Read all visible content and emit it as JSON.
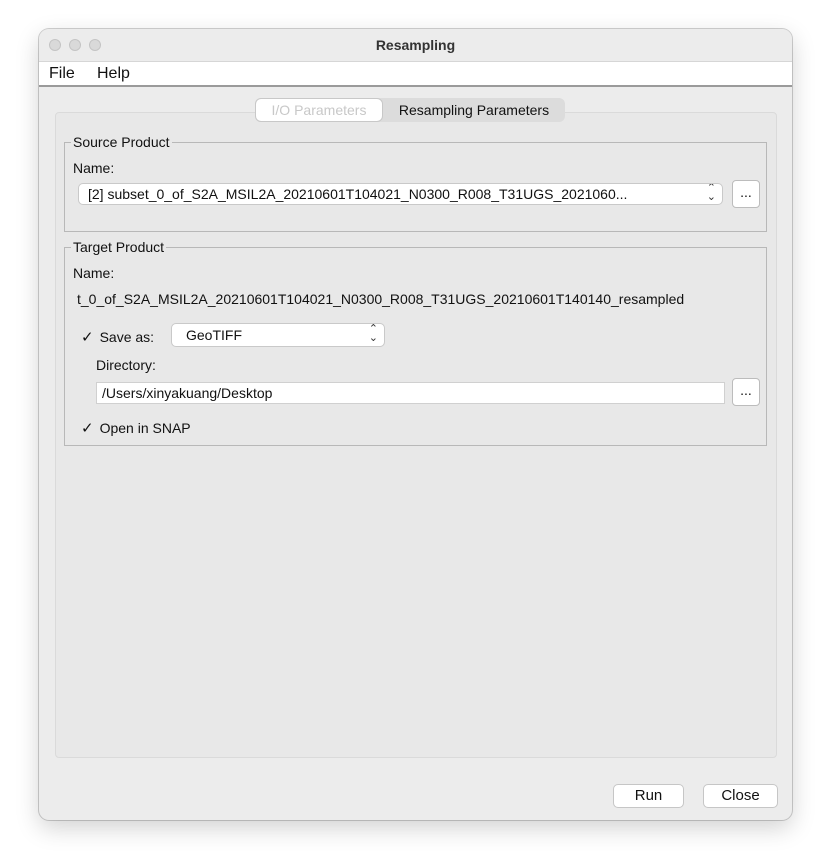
{
  "window": {
    "title": "Resampling"
  },
  "menu": {
    "file": "File",
    "help": "Help"
  },
  "tabs": [
    {
      "label": "I/O Parameters",
      "active": false
    },
    {
      "label": "Resampling Parameters",
      "active": true
    }
  ],
  "source_product": {
    "group_label": "Source Product",
    "name_label": "Name:",
    "selected": "[2] subset_0_of_S2A_MSIL2A_20210601T104021_N0300_R008_T31UGS_2021060...",
    "browse_label": "..."
  },
  "target_product": {
    "group_label": "Target Product",
    "name_label": "Name:",
    "name_value": "t_0_of_S2A_MSIL2A_20210601T104021_N0300_R008_T31UGS_20210601T140140_resampled",
    "save_as_label": "Save as:",
    "save_as_checked": true,
    "format": "GeoTIFF",
    "directory_label": "Directory:",
    "directory_value": "/Users/xinyakuang/Desktop",
    "browse_label": "...",
    "open_in_snap_label": "Open in SNAP",
    "open_in_snap_checked": true
  },
  "buttons": {
    "run": "Run",
    "close": "Close"
  }
}
